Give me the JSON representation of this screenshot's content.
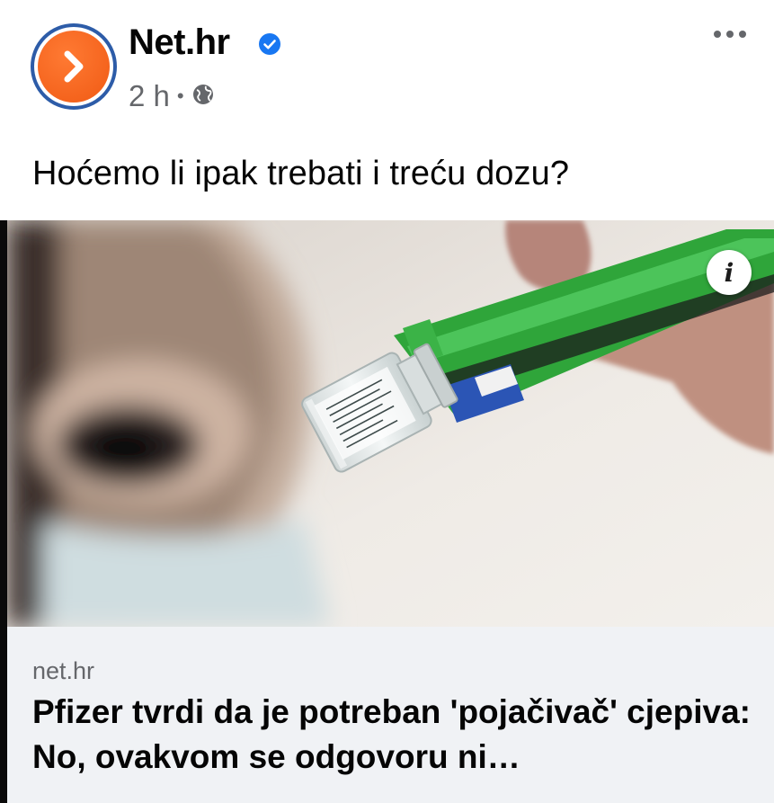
{
  "post": {
    "page_name": "Net.hr",
    "timestamp": "2 h",
    "separator": "•",
    "audience_icon": "globe-icon",
    "verified_icon": "verified-badge-icon",
    "more_icon": "more-options-icon",
    "text": "Hoćemo li ipak trebati i treću dozu?"
  },
  "link": {
    "domain": "net.hr",
    "title": "Pfizer tvrdi da je potreban 'pojačivač' cjepiva: No, ovakvom se odgovoru ni…",
    "info_label": "i",
    "image_icon": "vaccine-photo"
  },
  "colors": {
    "brand_orange": "#f05a14",
    "avatar_ring": "#2d5ca8",
    "verified_blue": "#1877f2",
    "meta_gray": "#65676b",
    "footer_bg": "#f0f2f5",
    "syringe_green": "#2fa53a"
  }
}
